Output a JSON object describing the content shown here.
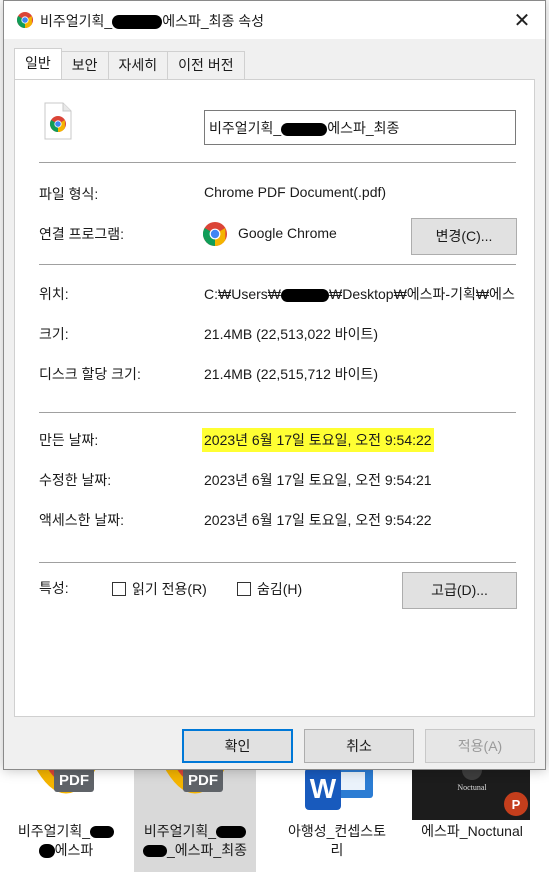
{
  "window": {
    "title_prefix": "비주얼기획_",
    "title_suffix": "에스파_최종 속성",
    "close_glyph": "✕"
  },
  "tabs": [
    {
      "label": "일반",
      "active": true
    },
    {
      "label": "보안",
      "active": false
    },
    {
      "label": "자세히",
      "active": false
    },
    {
      "label": "이전 버전",
      "active": false
    }
  ],
  "general": {
    "filename_prefix": "비주얼기획_",
    "filename_suffix": "에스파_최종",
    "file_type_label": "파일 형식:",
    "file_type_value": "Chrome PDF Document(.pdf)",
    "opens_with_label": "연결 프로그램:",
    "opens_with_value": "Google Chrome",
    "change_button": "변경(C)...",
    "location_label": "위치:",
    "location_prefix": "C:₩Users₩",
    "location_suffix": "₩Desktop₩에스파-기획₩에스",
    "size_label": "크기:",
    "size_value": "21.4MB (22,513,022 바이트)",
    "disk_size_label": "디스크 할당 크기:",
    "disk_size_value": "21.4MB (22,515,712 바이트)",
    "created_label": "만든 날짜:",
    "created_value": "2023년 6월 17일 토요일, 오전 9:54:22",
    "modified_label": "수정한 날짜:",
    "modified_value": "2023년 6월 17일 토요일, 오전 9:54:21",
    "accessed_label": "액세스한 날짜:",
    "accessed_value": "2023년 6월 17일 토요일, 오전 9:54:22",
    "attributes_label": "특성:",
    "readonly_label": "읽기 전용(R)",
    "hidden_label": "숨김(H)",
    "advanced_button": "고급(D)..."
  },
  "footer": {
    "ok": "확인",
    "cancel": "취소",
    "apply": "적용(A)"
  },
  "desktop": {
    "items": [
      {
        "line1": "비주얼기획_",
        "line2": "에스파",
        "selected": false,
        "type": "pdf"
      },
      {
        "line1": "비주얼기획_",
        "line2": "_에스파_최종",
        "selected": true,
        "type": "pdf"
      },
      {
        "line1": "아행성_컨셉스토",
        "line2": "리",
        "selected": false,
        "type": "word"
      },
      {
        "line1": "에스파_Noctunal",
        "line2": "",
        "selected": false,
        "type": "ppt"
      }
    ],
    "pdf_badge": "PDF",
    "word_badge": "W",
    "ppt_badge": "P",
    "ppt_thumb_title": "Noctunal"
  },
  "colors": {
    "highlight": "#ffff33",
    "primary_border": "#0078d7",
    "pdf_red": "#db4437",
    "pdf_green": "#0f9d58",
    "pdf_yellow": "#f4b400",
    "word_blue": "#185abd",
    "ppt_red": "#c43e1c"
  }
}
